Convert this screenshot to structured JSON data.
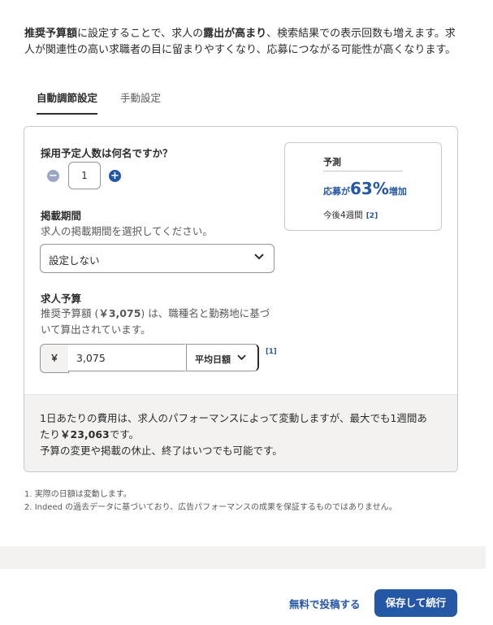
{
  "intro": {
    "part1_bold": "推奨予算額",
    "part2": "に設定することで、求人の",
    "part3_bold": "露出が高まり",
    "part4": "、検索結果での表示回数も増えます。求人が関連性の高い求職者の目に留まりやすくなり、応募につながる可能性が高くなります。"
  },
  "tabs": [
    {
      "label": "自動調節設定",
      "active": true
    },
    {
      "label": "手動設定",
      "active": false
    }
  ],
  "hires": {
    "question": "採用予定人数は何名ですか？",
    "value": "1",
    "minus_icon": "minus-circle-icon",
    "plus_icon": "plus-circle-icon"
  },
  "forecast": {
    "title": "予測",
    "prefix": "応募が",
    "percent": "63%",
    "suffix": "増加",
    "period": "今後4週間",
    "ref": "[2]"
  },
  "posting_period": {
    "label": "掲載期間",
    "description": "求人の掲載期間を選択してください。",
    "selected": "設定しない"
  },
  "budget": {
    "label": "求人予算",
    "desc_line1_a": "推奨予算額 (",
    "desc_line1_bold": "￥3,075",
    "desc_line1_b": ") は、職種名と勤務地に基づ",
    "desc_line2": "いて算出されています。",
    "currency": "￥",
    "amount": "3,075",
    "mode": "平均日額",
    "ref": "[1]"
  },
  "note": {
    "line1": "1日あたりの費用は、求人のパフォーマンスによって変動しますが、最大でも1週間あ",
    "line2_a": "たり",
    "line2_bold": "￥23,063",
    "line2_b": "です。",
    "line3": "予算の変更や掲載の休止、終了はいつでも可能です。"
  },
  "footnotes": [
    "1. 実際の日額は変動します。",
    "2. Indeed の過去データに基づいており、広告パフォーマンスの成果を保証するものではありません。"
  ],
  "footer": {
    "free_post": "無料で投稿する",
    "save_continue": "保存して続行"
  },
  "colors": {
    "accent": "#2557a7",
    "muted_icon": "#9aa6c4",
    "note_bg": "#f3f2f1"
  }
}
